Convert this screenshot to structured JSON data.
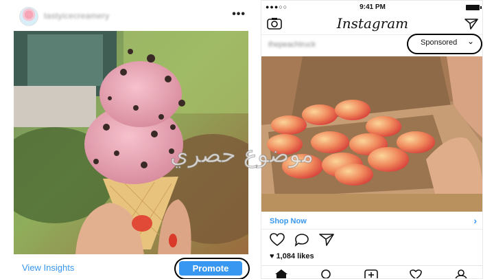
{
  "left_post": {
    "username": "tastyicecreamery",
    "more_icon": "ellipsis-icon",
    "more_glyph": "•••",
    "view_insights": "View Insights",
    "promote": "Promote"
  },
  "right_post": {
    "status": {
      "carrier": "●●●○○",
      "time": "9:41 PM"
    },
    "app_title": "Instagram",
    "ad_account": "thepeachtruck",
    "sponsored": "Sponsored",
    "sponsored_chevron": "⌄",
    "shop_now": "Shop Now",
    "shop_arrow": "›",
    "likes": "1,084 likes",
    "heart_glyph": "♥"
  },
  "watermark": "موضوع حصري",
  "colors": {
    "accent_blue": "#3897f0",
    "text_dark": "#111111"
  }
}
